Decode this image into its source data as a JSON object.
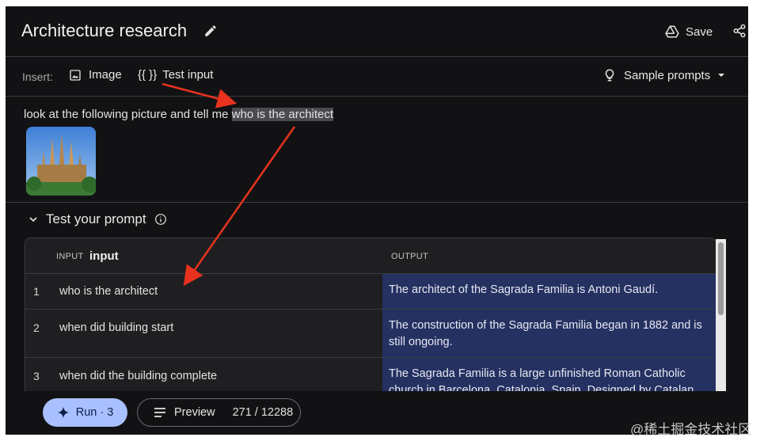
{
  "header": {
    "title": "Architecture research",
    "save_label": "Save"
  },
  "insert_bar": {
    "label": "Insert:",
    "image_label": "Image",
    "test_input_icon": "{{ }}",
    "test_input_label": "Test input",
    "sample_prompts_label": "Sample prompts"
  },
  "prompt": {
    "text_before": "look at the following picture and tell me ",
    "highlighted": "who is the architect",
    "image_icon": "sagrada-familia-image"
  },
  "test_section": {
    "title": "Test your prompt"
  },
  "table": {
    "header_input_small": "INPUT",
    "header_input_var": "input",
    "header_output": "OUTPUT",
    "rows": [
      {
        "num": "1",
        "input": "who is the architect",
        "output": "The architect of the Sagrada Familia is Antoni Gaudí."
      },
      {
        "num": "2",
        "input": "when did building start",
        "output": "The construction of the Sagrada Familia began in 1882 and is still ongoing."
      },
      {
        "num": "3",
        "input": "when did the building complete",
        "output": "The Sagrada Familia is a large unfinished Roman Catholic church in Barcelona, Catalonia, Spain. Designed by Catalan"
      }
    ]
  },
  "bottom": {
    "run_label": "Run · 3",
    "preview_label": "Preview",
    "token_count": "271 / 12288"
  },
  "watermark": "@稀土掘金技术社区",
  "colors": {
    "background": "#121214",
    "accent": "#a8c0ff",
    "output_cell": "#253161",
    "arrow": "#e8321e"
  },
  "icons": [
    "pencil-icon",
    "drive-icon",
    "share-icon",
    "image-icon",
    "lightbulb-icon",
    "caret-down-icon",
    "chevron-down-icon",
    "info-icon",
    "sparkle-icon",
    "preview-lines-icon"
  ]
}
